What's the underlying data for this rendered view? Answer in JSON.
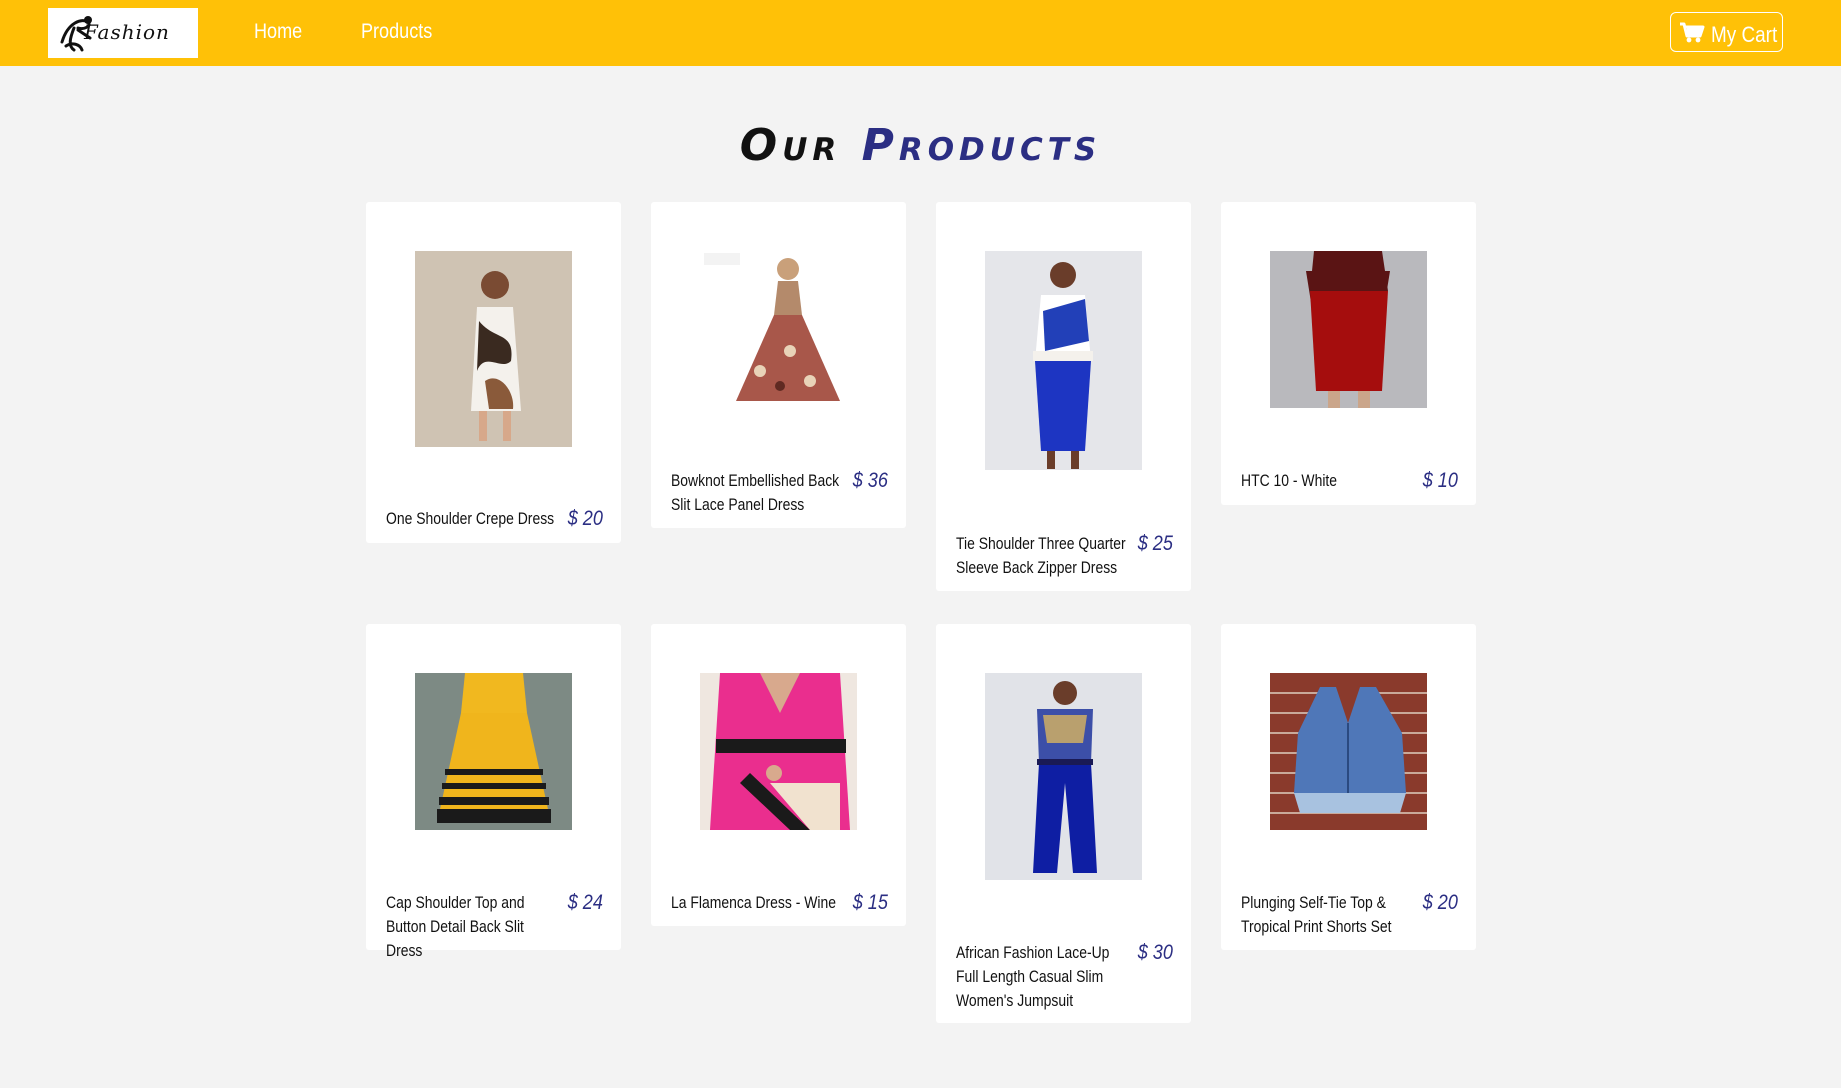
{
  "navbar": {
    "logo_text": "Fashion",
    "links": [
      {
        "label": "Home"
      },
      {
        "label": "Products"
      }
    ],
    "cart_label": "My Cart"
  },
  "page": {
    "title_part1": "Our",
    "title_part2": "Products"
  },
  "products": [
    {
      "name": "One Shoulder Crepe Dress",
      "price": "$ 20"
    },
    {
      "name": "Bowknot Embellished Back Slit Lace Panel Dress",
      "price": "$ 36"
    },
    {
      "name": "Tie Shoulder Three Quarter Sleeve Back Zipper Dress",
      "price": "$ 25"
    },
    {
      "name": "HTC 10 - White",
      "price": "$ 10"
    },
    {
      "name": "Cap Shoulder Top and Button Detail Back Slit Dress",
      "price": "$ 24"
    },
    {
      "name": "La Flamenca Dress - Wine",
      "price": "$ 15"
    },
    {
      "name": "African Fashion Lace-Up Full Length Casual Slim Women's Jumpsuit",
      "price": "$ 30"
    },
    {
      "name": "Plunging Self-Tie Top & Tropical Print Shorts Set",
      "price": "$ 20"
    }
  ],
  "colors": {
    "navbar": "#ffc107",
    "accent": "#2b2e83",
    "background": "#f3f3f3"
  }
}
